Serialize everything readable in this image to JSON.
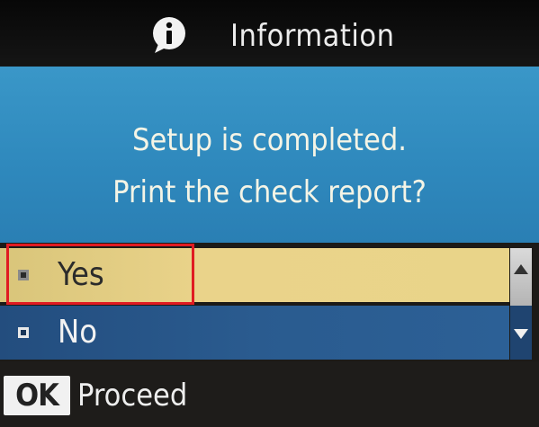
{
  "header": {
    "icon": "info-icon",
    "title": "Information"
  },
  "message": {
    "line1": "Setup is completed.",
    "line2": "Print the check report?"
  },
  "options": [
    {
      "label": "Yes",
      "selected": true
    },
    {
      "label": "No",
      "selected": false
    }
  ],
  "footer": {
    "key": "OK",
    "action": "Proceed"
  },
  "colors": {
    "title_bar": "#0d0d0d",
    "message_background": "#3291c4",
    "selected_option": "#e6d086",
    "unselected_option": "#2a5b8f",
    "highlight_border": "#e01b22"
  }
}
